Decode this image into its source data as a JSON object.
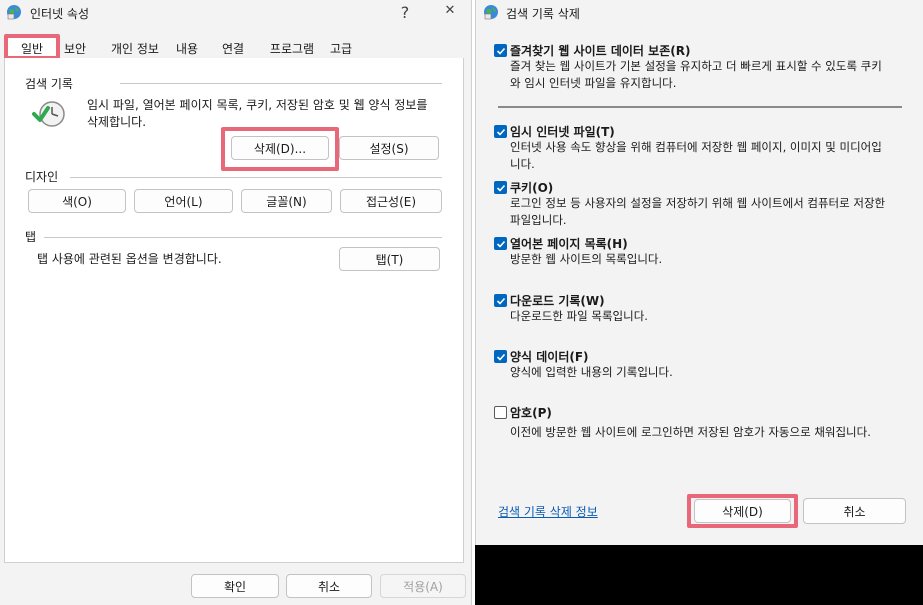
{
  "internet_options": {
    "title": "인터넷 속성",
    "help_symbol": "?",
    "close_symbol": "✕",
    "tabs": [
      "일반",
      "보안",
      "개인 정보",
      "내용",
      "연결",
      "프로그램",
      "고급"
    ],
    "browsing_history": {
      "label": "검색 기록",
      "description": "임시 파일, 열어본 페이지 목록, 쿠키, 저장된 암호 및 웹 양식 정보를 삭제합니다.",
      "delete_button": "삭제(D)...",
      "settings_button": "설정(S)"
    },
    "appearance": {
      "label": "디자인",
      "buttons": [
        "색(O)",
        "언어(L)",
        "글꼴(N)",
        "접근성(E)"
      ]
    },
    "tabs_group": {
      "label": "탭",
      "description": "탭 사용에 관련된 옵션을 변경합니다.",
      "button": "탭(T)"
    },
    "footer": {
      "ok": "확인",
      "cancel": "취소",
      "apply": "적용(A)"
    }
  },
  "delete_history": {
    "title": "검색 기록 삭제",
    "options": [
      {
        "title": "즐겨찾기 웹 사이트 데이터 보존(R)",
        "desc": "즐겨 찾는 웹 사이트가 기본 설정을 유지하고 더 빠르게 표시할 수 있도록 쿠키와 임시 인터넷 파일을 유지합니다.",
        "checked": true
      },
      {
        "title": "임시 인터넷 파일(T)",
        "desc": "인터넷 사용 속도 향상을 위해 컴퓨터에 저장한 웹 페이지, 이미지 및 미디어입니다.",
        "checked": true
      },
      {
        "title": "쿠키(O)",
        "desc": "로그인 정보 등 사용자의 설정을 저장하기 위해 웹 사이트에서 컴퓨터로 저장한 파일입니다.",
        "checked": true
      },
      {
        "title": "열어본 페이지 목록(H)",
        "desc": "방문한 웹 사이트의 목록입니다.",
        "checked": true
      },
      {
        "title": "다운로드 기록(W)",
        "desc": "다운로드한 파일 목록입니다.",
        "checked": true
      },
      {
        "title": "양식 데이터(F)",
        "desc": "양식에 입력한 내용의 기록입니다.",
        "checked": true
      },
      {
        "title": "암호(P)",
        "desc": "이전에 방문한 웹 사이트에 로그인하면 저장된 암호가 자동으로 채워집니다.",
        "checked": false
      }
    ],
    "about_link": "검색 기록 삭제 정보",
    "delete_button": "삭제(D)",
    "cancel_button": "취소"
  },
  "colors": {
    "accent": "#0067c0",
    "highlight": "#e8687a",
    "link": "#0a5cb5"
  }
}
